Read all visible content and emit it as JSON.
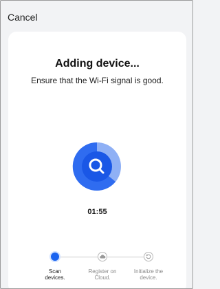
{
  "header": {
    "cancel_label": "Cancel"
  },
  "main": {
    "title": "Adding device...",
    "subtitle": "Ensure that the Wi-Fi signal is good.",
    "timer": "01:55",
    "progress_icon": "search-icon",
    "colors": {
      "accent": "#1a64f0",
      "accent_light": "#8fb0f5",
      "ring_dark": "#2f6cf0"
    }
  },
  "steps": [
    {
      "label_line1": "Scan",
      "label_line2": "devices.",
      "state": "active",
      "icon": "scan-icon"
    },
    {
      "label_line1": "Register on",
      "label_line2": "Cloud.",
      "state": "pending",
      "icon": "cloud-icon"
    },
    {
      "label_line1": "Initialize the",
      "label_line2": "device.",
      "state": "pending",
      "icon": "initialize-icon"
    }
  ]
}
